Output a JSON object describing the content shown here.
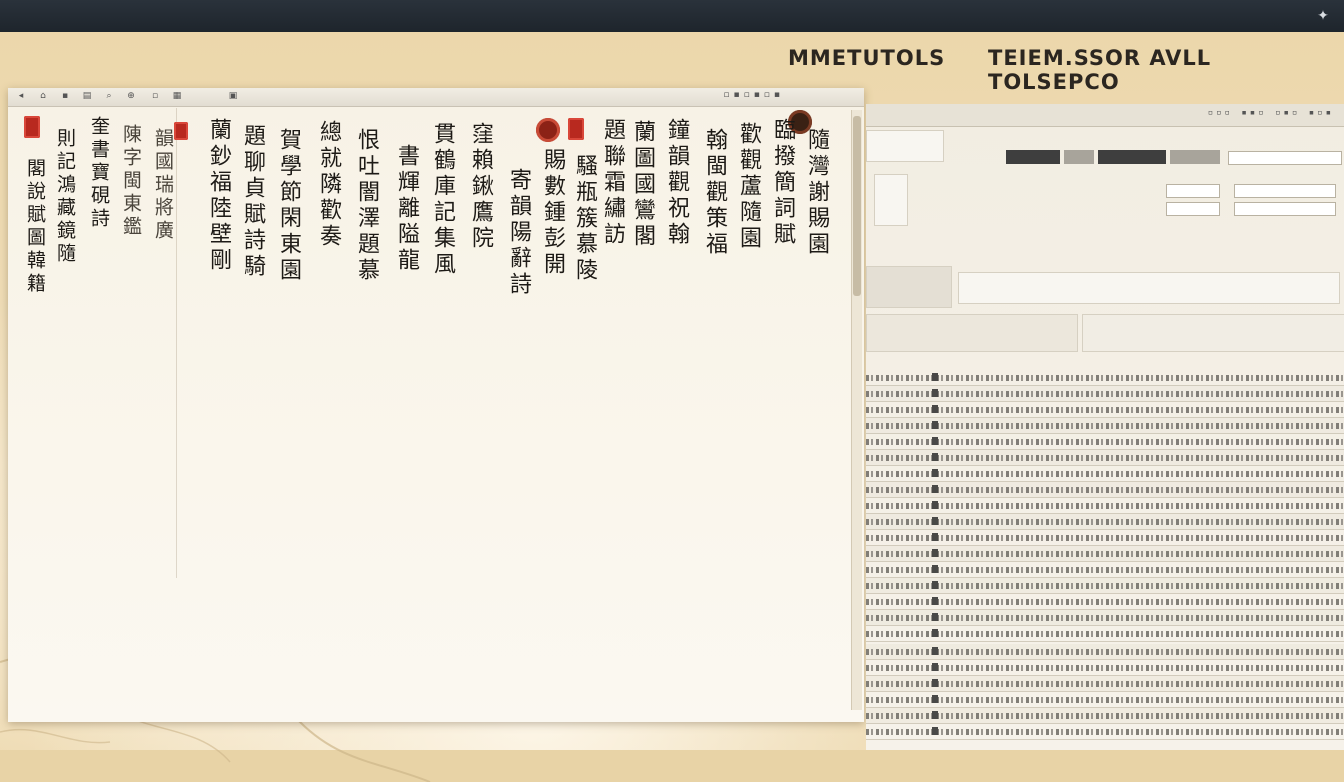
{
  "header": {
    "left_title": "MMETUTOLS",
    "right_title": "TEIEM.SSOR AVLL TOLSEPCO"
  },
  "icons": {
    "system": "settings-icon",
    "doc_toolbar": [
      "back-icon",
      "home-icon",
      "bookmark-icon",
      "print-icon",
      "search-icon",
      "zoom-icon"
    ]
  },
  "manuscript": {
    "columns_left": [
      "閣說賦圖韓籍",
      "則記鴻藏鏡隨",
      "奎書寶硯詩",
      "陳字閩東鑑",
      "韻國瑞將廣"
    ],
    "columns_main": [
      "蘭鈔福陸壁剛",
      "題聊貞賦詩騎",
      "賀學節閑東園",
      "總就隣歡奏",
      "恨吐闇澤題慕",
      "書輝離隘龍",
      "貫鶴庫記集風",
      "窪賴鍬鷹院",
      "寄韻陽辭詩",
      "賜數鍾彭開",
      "騷瓶簇慕陵",
      "題聯霜繡訪",
      "蘭圖國鸞閣",
      "鐘韻觀祝翰",
      "翰閩觀策福",
      "歡觀蘆隨園",
      "臨撥簡詞賦",
      "隨灣謝賜園"
    ]
  },
  "colors": {
    "seal_red": "#b8291f",
    "ink": "#1d1a16",
    "parchment": "#ecd7ab",
    "titlebar": "#2a323b"
  }
}
